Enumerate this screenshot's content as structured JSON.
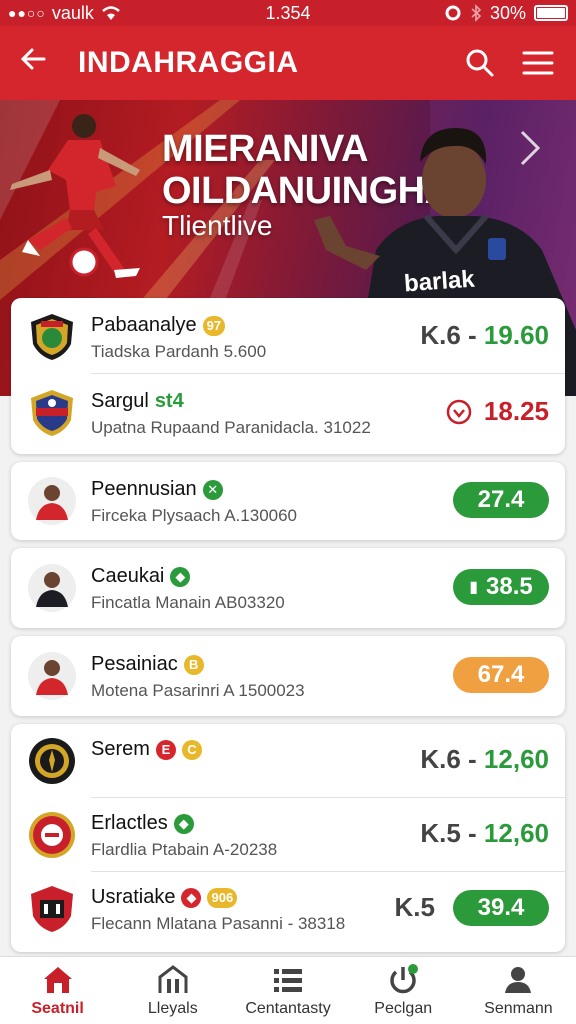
{
  "status_bar": {
    "carrier": "vaulk",
    "time": "1.354",
    "battery": "30%"
  },
  "header": {
    "title": "INDAHRAGGIA"
  },
  "banner": {
    "title_line1": "MIERANIVA",
    "title_line2": "OILDANUINGHA",
    "subtitle": "Tlientlive",
    "jersey_text": "barlak"
  },
  "cards": [
    {
      "rows": [
        {
          "name": "Pabaanalye",
          "badge": "97",
          "sub": "Tiadska Pardanh 5.600",
          "odds_left": "K.6 -",
          "odds_right": "19.60"
        },
        {
          "name": "Sargul",
          "tag": "st4",
          "sub": "Upatna Rupaand Paranidacla. 31022",
          "odds": "18.25"
        }
      ]
    },
    {
      "rows": [
        {
          "name": "Peennusian",
          "sub": "Firceka Plysaach A.130060",
          "pill": "27.4"
        }
      ]
    },
    {
      "rows": [
        {
          "name": "Caeukai",
          "sub": "Fincatla Manain AB03320",
          "pill": "38.5"
        }
      ]
    },
    {
      "rows": [
        {
          "name": "Pesainiac",
          "sub": "Motena Pasarinri A 1500023",
          "pill": "67.4"
        }
      ]
    },
    {
      "rows": [
        {
          "name": "Serem",
          "odds_left": "K.6 -",
          "odds_right": "12,60"
        },
        {
          "name": "Erlactles",
          "sub": "Flardlia Ptabain A-20238",
          "odds_left": "K.5 -",
          "odds_right": "12,60"
        },
        {
          "name": "Usratiake",
          "badge": "906",
          "sub": "Flecann Mlatana Pasanni - 38318",
          "odds_left": "K.5",
          "pill": "39.4"
        }
      ]
    }
  ],
  "bottom_nav": [
    {
      "label": "Seatnil",
      "active": true
    },
    {
      "label": "Lleyals"
    },
    {
      "label": "Centantasty"
    },
    {
      "label": "Peclgan"
    },
    {
      "label": "Senmann"
    }
  ],
  "colors": {
    "brand_red": "#d5262d",
    "odds_green": "#2a9a3a",
    "pill_orange": "#f0a040"
  }
}
